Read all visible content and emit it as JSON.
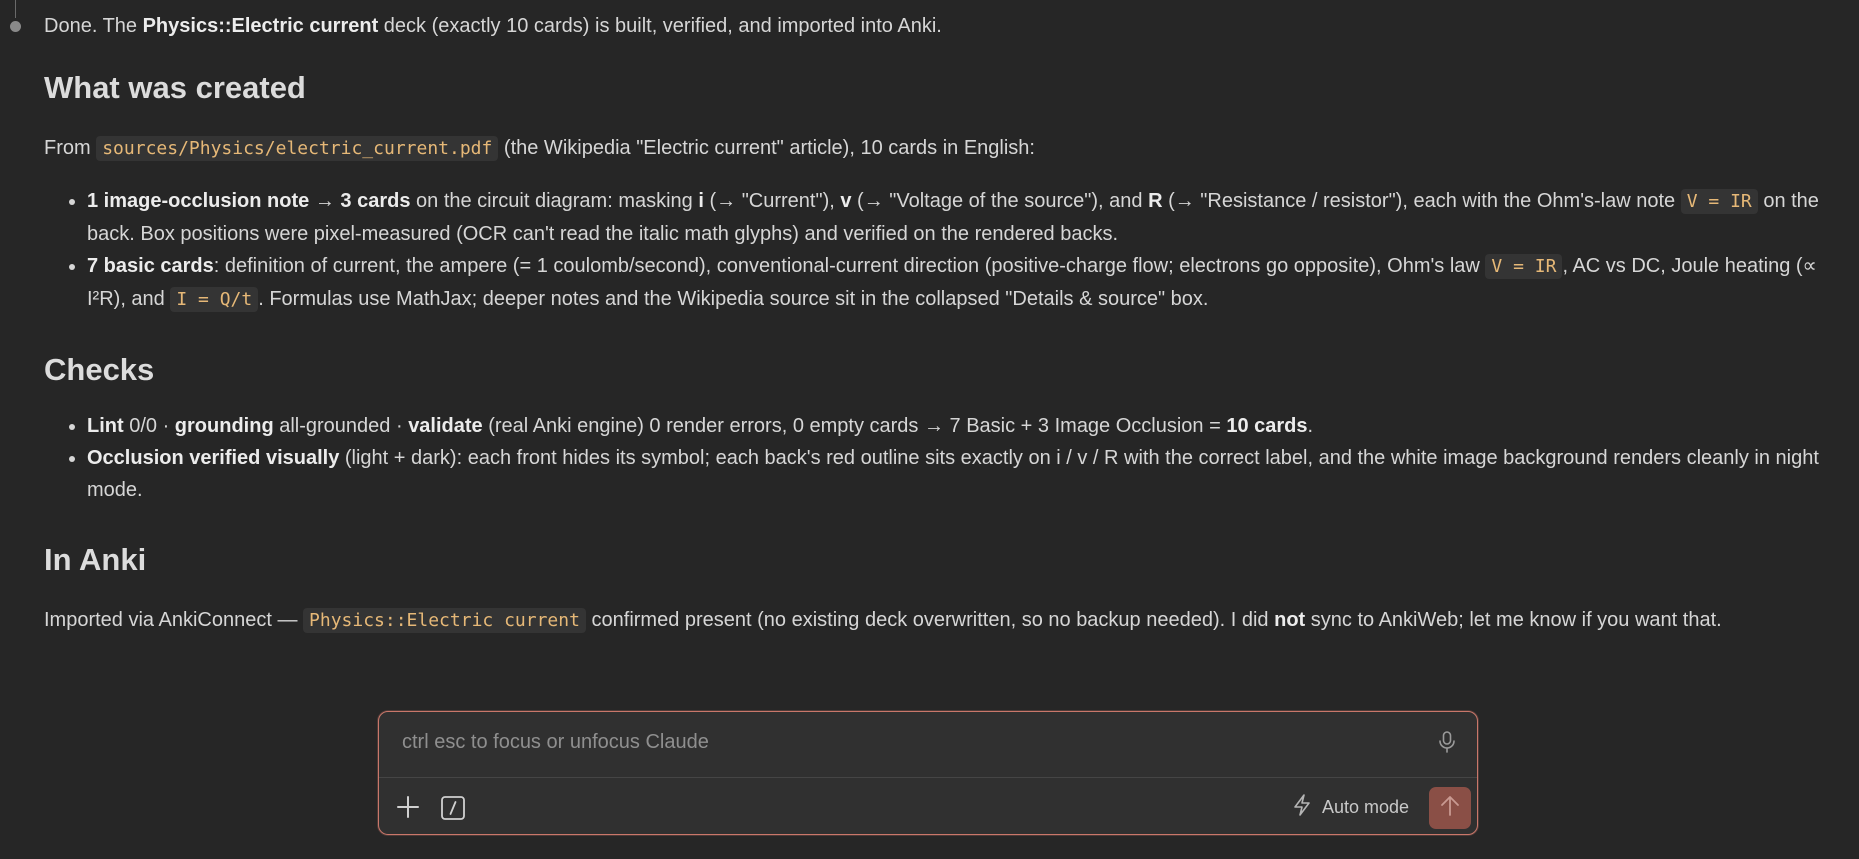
{
  "message": {
    "intro": {
      "t1": "Done. The ",
      "b1": "Physics::Electric current",
      "t2": " deck (exactly 10 cards) is built, verified, and imported into Anki."
    },
    "created": {
      "heading": "What was created",
      "from": {
        "t1": "From ",
        "code": "sources/Physics/electric_current.pdf",
        "t2": " (the Wikipedia \"Electric current\" article), 10 cards in English:"
      },
      "item1": {
        "b1": "1 image-occlusion note",
        "t1": " → ",
        "b2": "3 cards",
        "t2": " on the circuit diagram: masking ",
        "b3": "i",
        "t3": " (→ \"Current\"), ",
        "b4": "v",
        "t4": " (→ \"Voltage of the source\"), and ",
        "b5": "R",
        "t5": " (→ \"Resistance / resistor\"), each with the Ohm's-law note ",
        "code": "V = IR",
        "t6": " on the back. Box positions were pixel-measured (OCR can't read the italic math glyphs) and verified on the rendered backs."
      },
      "item2": {
        "b1": "7 basic cards",
        "t1": ": definition of current, the ampere (= 1 coulomb/second), conventional-current direction (positive-charge flow; electrons go opposite), Ohm's law ",
        "code1": "V = IR",
        "t2": ", AC vs DC, Joule heating (∝ I²R), and ",
        "code2": "I = Q/t",
        "t3": ". Formulas use MathJax; deeper notes and the Wikipedia source sit in the collapsed \"Details & source\" box."
      }
    },
    "checks": {
      "heading": "Checks",
      "item1": {
        "b1": "Lint",
        "t1": " 0/0 · ",
        "b2": "grounding",
        "t2": " all-grounded · ",
        "b3": "validate",
        "t3": " (real Anki engine) 0 render errors, 0 empty cards → 7 Basic + 3 Image Occlusion = ",
        "b4": "10 cards",
        "t4": "."
      },
      "item2": {
        "b1": "Occlusion verified visually",
        "t1": " (light + dark): each front hides its symbol; each back's red outline sits exactly on i / v / R with the correct label, and the white image background renders cleanly in night mode."
      }
    },
    "anki": {
      "heading": "In Anki",
      "t1": "Imported via AnkiConnect — ",
      "code": "Physics::Electric current",
      "t2": " confirmed present (no existing deck overwritten, so no backup needed). I did ",
      "b1": "not",
      "t3": " sync to AnkiWeb; let me know if you want that."
    }
  },
  "composer": {
    "placeholder": "ctrl esc to focus or unfocus Claude",
    "auto_mode_label": "Auto mode",
    "icons": {
      "mic": "microphone-icon",
      "plus": "plus-icon",
      "slash": "slash-command-icon",
      "bolt": "lightning-icon",
      "send": "arrow-up-icon"
    },
    "colors": {
      "border": "#c9776a",
      "send_bg": "#8a4f46"
    }
  }
}
